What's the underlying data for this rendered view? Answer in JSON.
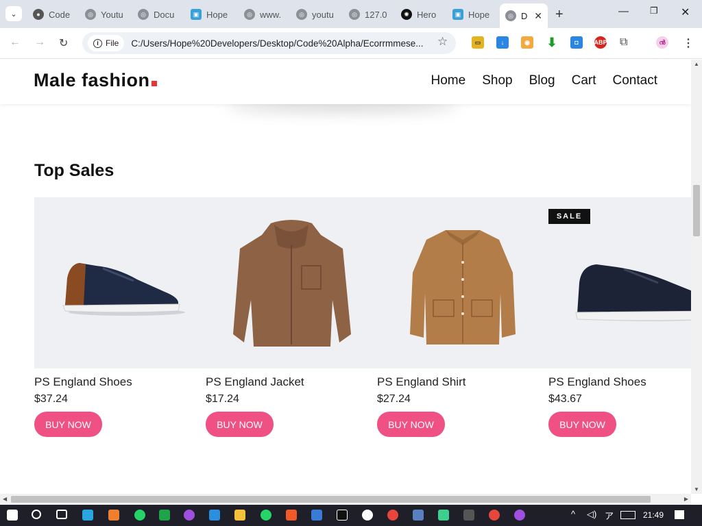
{
  "browser": {
    "tabs": [
      {
        "label": "Code",
        "color": "#555"
      },
      {
        "label": "Youtu",
        "color": "#8a8f98"
      },
      {
        "label": "Docu",
        "color": "#8a8f98"
      },
      {
        "label": "Hope",
        "color": "#3aa0d8"
      },
      {
        "label": "www.",
        "color": "#8a8f98"
      },
      {
        "label": "youtu",
        "color": "#8a8f98"
      },
      {
        "label": "127.0",
        "color": "#8a8f98"
      },
      {
        "label": "Hero",
        "color": "#111"
      },
      {
        "label": "Hope",
        "color": "#3aa0d8"
      },
      {
        "label": "D",
        "color": "#8a8f98"
      }
    ],
    "omnibox_badge": "File",
    "url": "C:/Users/Hope%20Developers/Desktop/Code%20Alpha/Ecorrmmese..."
  },
  "site": {
    "logo": "Male fashion",
    "nav": [
      "Home",
      "Shop",
      "Blog",
      "Cart",
      "Contact"
    ],
    "section_title": "Top Sales",
    "sale_badge": "SALE",
    "buy_label": "BUY NOW",
    "products": [
      {
        "name": "PS England Shoes",
        "price": "$37.24",
        "image": "sneaker-brown-navy"
      },
      {
        "name": "PS England Jacket",
        "price": "$17.24",
        "image": "hooded-jacket-brown"
      },
      {
        "name": "PS England Shirt",
        "price": "$27.24",
        "image": "overshirt-tan"
      },
      {
        "name": "PS England Shoes",
        "price": "$43.67",
        "image": "sneaker-navy"
      }
    ],
    "accent_color": "#ef5185",
    "logo_dot_color": "#e53637"
  },
  "taskbar": {
    "time": "21:49"
  }
}
